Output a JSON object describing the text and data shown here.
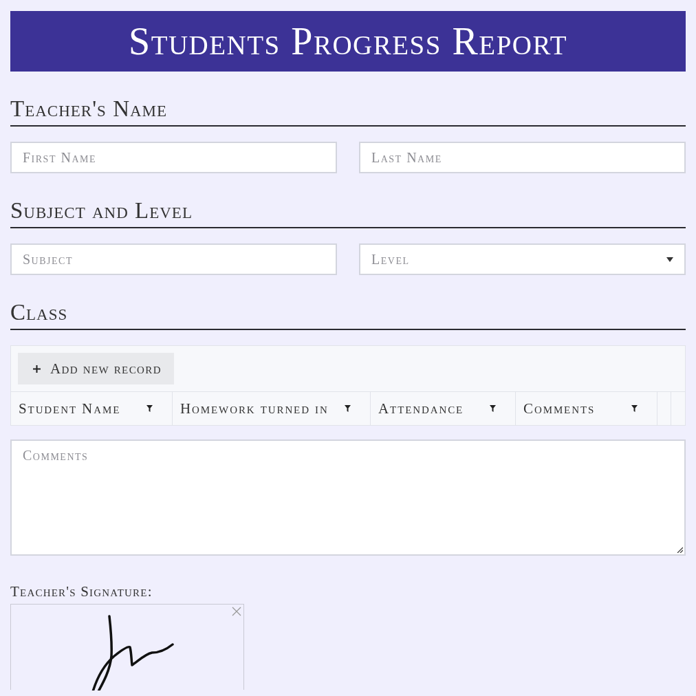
{
  "header": {
    "title": "Students Progress Report"
  },
  "sections": [
    {
      "heading": "Teacher's Name",
      "fields": [
        {
          "kind": "text",
          "placeholder": "First Name"
        },
        {
          "kind": "text",
          "placeholder": "Last Name"
        }
      ]
    },
    {
      "heading": "Subject and Level",
      "fields": [
        {
          "kind": "text",
          "placeholder": "Subject"
        },
        {
          "kind": "select",
          "placeholder": "Level"
        }
      ]
    }
  ],
  "class_section": {
    "heading": "Class",
    "grid": {
      "add_button": "Add new record",
      "columns": [
        "Student Name",
        "Homework turned in",
        "Attendance",
        "Comments"
      ]
    },
    "comments": {
      "placeholder": "Comments"
    }
  },
  "signature": {
    "label": "Teacher's Signature:"
  }
}
